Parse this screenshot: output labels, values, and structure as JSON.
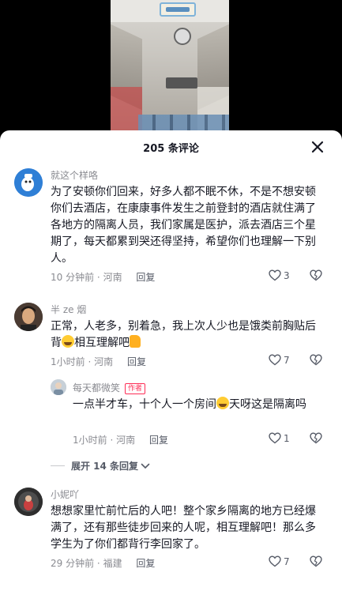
{
  "header": {
    "title": "205 条评论",
    "close_label": "×"
  },
  "comments": [
    {
      "user": "就这个样咯",
      "text": "为了安顿你们回来，好多人都不眠不休，不是不想安顿你们去酒店，在康康事件发生之前登封的酒店就住满了各地方的隔离人员，我们家属是医护，派去酒店三个星期了，每天都累到哭还得坚持，希望你们也理解一下别人。",
      "time": "10 分钟前",
      "location": "河南",
      "reply_label": "回复",
      "likes": "3"
    },
    {
      "user": "半 ze 烟",
      "text_a": "正常，人老多，别着急，我上次人少也是饿类前胸贴后背",
      "text_b": "相互理解吧",
      "time": "1小时前",
      "location": "河南",
      "reply_label": "回复",
      "likes": "7"
    },
    {
      "user": "每天都微笑",
      "author_tag": "作者",
      "text_a": "一点半才车，十个人一个房间",
      "text_b": "天呀这是隔离吗",
      "time": "1小时前",
      "location": "河南",
      "reply_label": "回复",
      "likes": "1"
    },
    {
      "user": "小妮吖",
      "text": "想想家里忙前忙后的人吧！整个家乡隔离的地方已经爆满了，还有那些徒步回来的人呢，相互理解吧！那么多学生为了你们都背行李回家了。",
      "time": "29 分钟前",
      "location": "福建",
      "reply_label": "回复",
      "likes": "7"
    }
  ],
  "expand": {
    "label": "展开 14 条回复"
  },
  "meta_sep": "·",
  "colors": {
    "text": "#161823",
    "muted": "#8a8b91",
    "author_tag": "#fe2c55"
  }
}
